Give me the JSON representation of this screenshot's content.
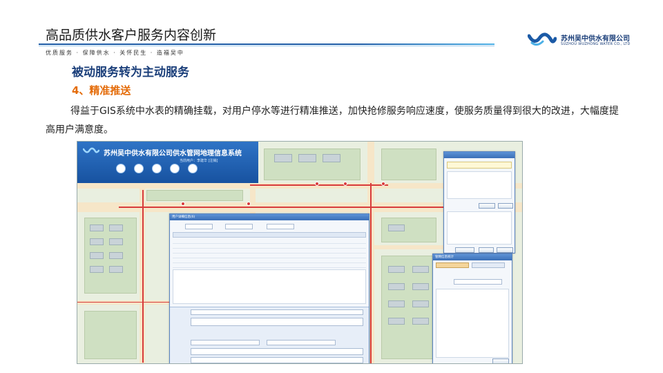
{
  "header": {
    "title": "高品质供水客户服务内容创新",
    "slogan": "优质服务 · 保障供水 · 关怀民生 · 造福吴中"
  },
  "logo": {
    "name_cn": "苏州吴中供水有限公司",
    "name_en": "SUZHOU WUZHONG WATER CO., LTD"
  },
  "content": {
    "section_heading": "被动服务转为主动服务",
    "sub_heading": "4、精准推送",
    "paragraph": "得益于GIS系统中水表的精确挂载，对用户停水等进行精准推送，加快抢修服务响应速度，使服务质量得到很大的改进，大幅度提高用户满意度。"
  },
  "gis": {
    "system_title": "苏州吴中供水有限公司供水管网地理信息系统",
    "user_line": "当前用户：李建华 [注销]",
    "dialog_title": "用户详细信息(6)",
    "stats_title": "管网信息统计"
  },
  "colors": {
    "brand_blue": "#1b3f7a",
    "accent_orange": "#e46c0a",
    "line_blue": "#1b5aa6"
  }
}
